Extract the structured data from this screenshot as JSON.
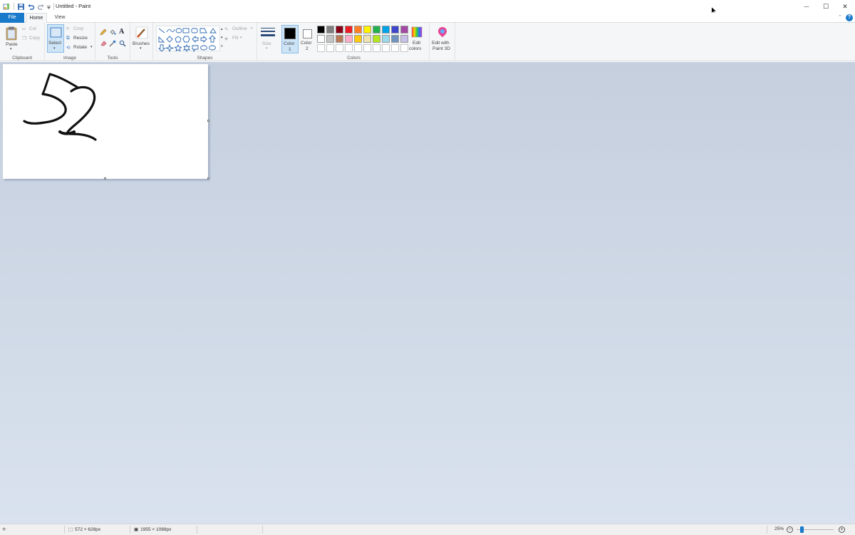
{
  "window": {
    "title": "Untitled - Paint"
  },
  "window_controls": {
    "minimize": "—",
    "maximize": "☐",
    "close": "✕"
  },
  "tabs": {
    "file": "File",
    "home": "Home",
    "view": "View"
  },
  "ribbon": {
    "clipboard": {
      "label": "Clipboard",
      "paste": "Paste",
      "cut": "Cut",
      "copy": "Copy"
    },
    "image": {
      "label": "Image",
      "select": "Select",
      "crop": "Crop",
      "resize": "Resize",
      "rotate": "Rotate"
    },
    "tools": {
      "label": "Tools"
    },
    "brushes": {
      "label": "Brushes"
    },
    "shapes": {
      "label": "Shapes",
      "outline": "Outline",
      "fill": "Fill"
    },
    "size": {
      "label": "Size"
    },
    "colors": {
      "label": "Colors",
      "color1_line1": "Color",
      "color1_line2": "1",
      "color2_line1": "Color",
      "color2_line2": "2",
      "edit_line1": "Edit",
      "edit_line2": "colors",
      "paint3d_line1": "Edit with",
      "paint3d_line2": "Paint 3D",
      "color1": "#000000",
      "color2": "#ffffff",
      "palette_row1": [
        "#000000",
        "#7f7f7f",
        "#880015",
        "#ed1c24",
        "#ff7f27",
        "#fff200",
        "#22b14c",
        "#00a2e8",
        "#3f48cc",
        "#a349a4"
      ],
      "palette_row2": [
        "#ffffff",
        "#c3c3c3",
        "#b97a57",
        "#ffaec9",
        "#ffc90e",
        "#efe4b0",
        "#b5e61d",
        "#99d9ea",
        "#7092be",
        "#c8bfe7"
      ]
    }
  },
  "status": {
    "selection_size": "572 × 628px",
    "image_size": "1955 × 1088px",
    "zoom": "25%"
  }
}
